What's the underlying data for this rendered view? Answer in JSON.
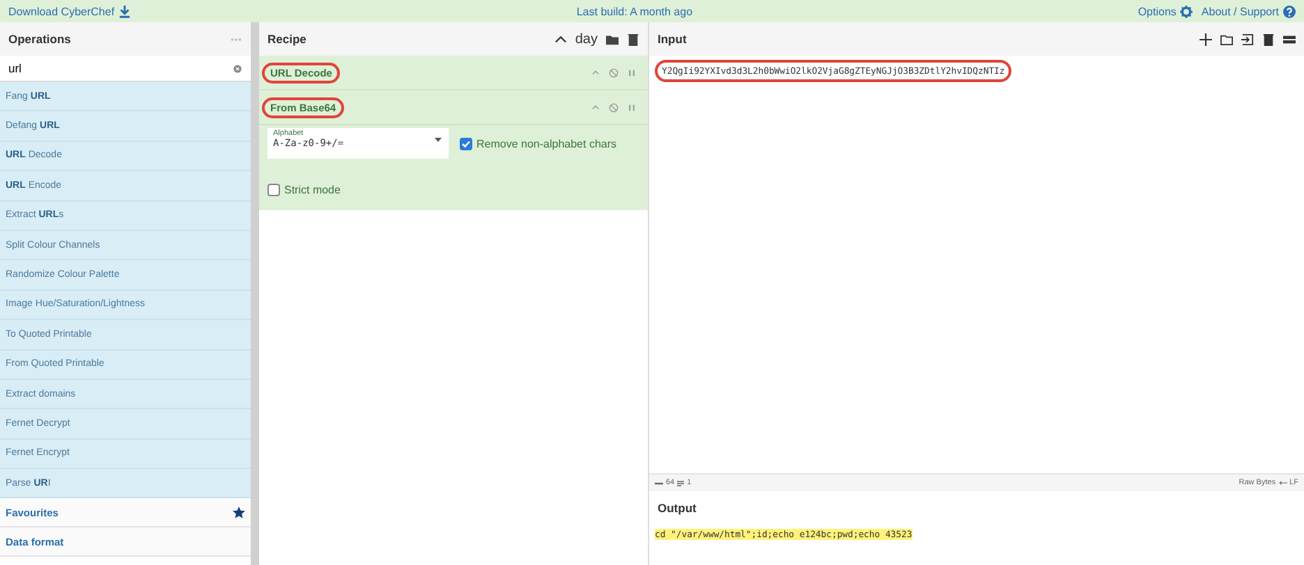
{
  "top_bar": {
    "download": "Download CyberChef",
    "build": "Last build: A month ago",
    "options": "Options",
    "about": "About / Support"
  },
  "operations": {
    "title": "Operations",
    "search": {
      "value": "url"
    },
    "items": [
      {
        "label": "Fang **URL**"
      },
      {
        "label": "Defang **URL**"
      },
      {
        "label": "**URL** Decode"
      },
      {
        "label": "**URL** Encode"
      },
      {
        "label": "Extract **URL**s"
      },
      {
        "label": "Split Colour Channels"
      },
      {
        "label": "Randomize Colour Palette"
      },
      {
        "label": "Image Hue/Saturation/Lightness"
      },
      {
        "label": "To Quoted Printable"
      },
      {
        "label": "From Quoted Printable"
      },
      {
        "label": "Extract domains"
      },
      {
        "label": "Fernet Decrypt"
      },
      {
        "label": "Fernet Encrypt"
      },
      {
        "label": "Parse **UR**I"
      }
    ],
    "categories": [
      {
        "label": "Favourites",
        "starred": true
      },
      {
        "label": "Data format",
        "starred": false
      }
    ]
  },
  "recipe": {
    "title": "Recipe",
    "header_text": "day",
    "steps": [
      {
        "name": "URL Decode",
        "highlighted": true
      },
      {
        "name": "From Base64",
        "highlighted": true
      }
    ],
    "args": {
      "alphabet_label": "Alphabet",
      "alphabet_value": "A-Za-z0-9+/=",
      "remove_label": "Remove non-alphabet chars",
      "remove_checked": true,
      "strict_label": "Strict mode",
      "strict_checked": false
    }
  },
  "input": {
    "title": "Input",
    "value": "Y2QgIi92YXIvd3d3L2h0bWwiO2lkO2VjaG8gZTEyNGJjO3B3ZDtlY2hvIDQzNTIz",
    "highlighted": true,
    "status": {
      "length": "64",
      "lines": "1",
      "raw_bytes": "Raw Bytes",
      "eol": "LF"
    }
  },
  "output": {
    "title": "Output",
    "value": "cd \"/var/www/html\";id;echo e124bc;pwd;echo 43523"
  }
}
